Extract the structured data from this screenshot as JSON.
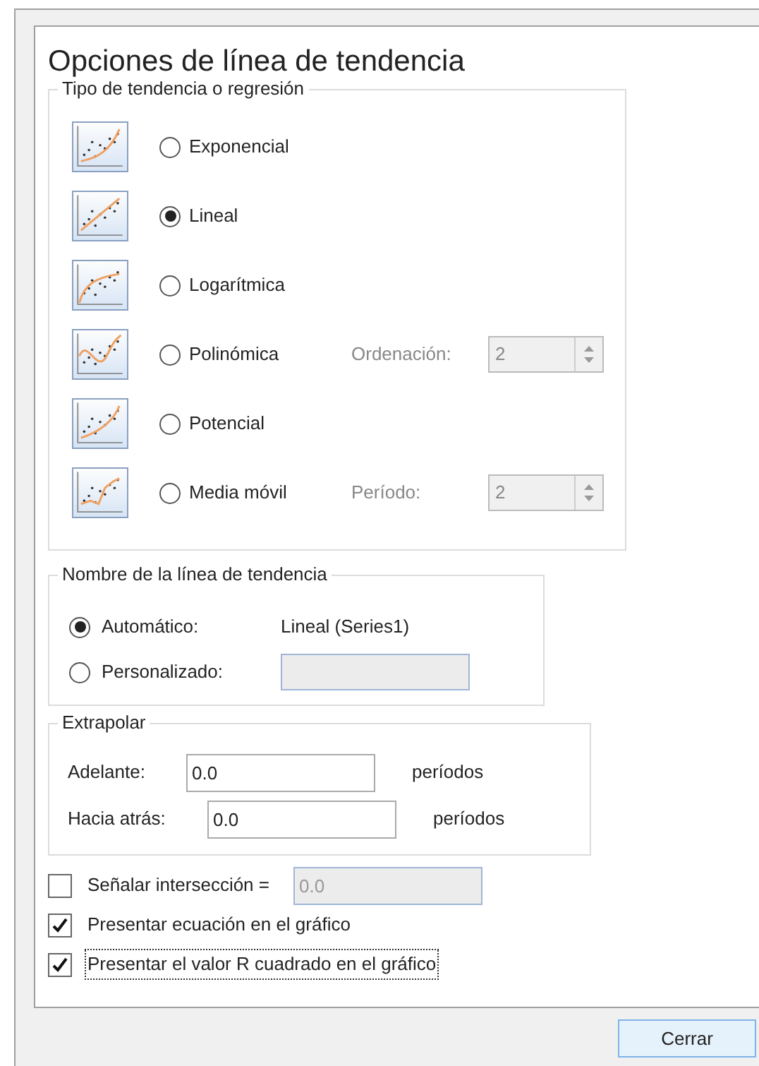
{
  "title": "Opciones de línea de tendencia",
  "trend_type": {
    "legend": "Tipo de tendencia o regresión",
    "options": [
      {
        "kind": "exponential",
        "label": "Exponencial",
        "selected": false
      },
      {
        "kind": "linear",
        "label": "Lineal",
        "selected": true
      },
      {
        "kind": "logarithmic",
        "label": "Logarítmica",
        "selected": false
      },
      {
        "kind": "polynomial",
        "label": "Polinómica",
        "selected": false,
        "param": {
          "label": "Ordenación:",
          "value": "2",
          "disabled": true
        }
      },
      {
        "kind": "power",
        "label": "Potencial",
        "selected": false
      },
      {
        "kind": "moving_average",
        "label": "Media móvil",
        "selected": false,
        "param": {
          "label": "Período:",
          "value": "2",
          "disabled": true
        }
      }
    ]
  },
  "trendline_name": {
    "legend": "Nombre de la línea de tendencia",
    "options": [
      {
        "kind": "auto",
        "label": "Automático:",
        "selected": true,
        "value": "Lineal (Series1)"
      },
      {
        "kind": "custom",
        "label": "Personalizado:",
        "selected": false,
        "field_disabled": true
      }
    ]
  },
  "extrapolate": {
    "legend": "Extrapolar",
    "fields": [
      {
        "label": "Adelante:",
        "value": "0.0",
        "unit": "períodos"
      },
      {
        "label": "Hacia atrás:",
        "value": "0.0",
        "unit": "períodos"
      }
    ]
  },
  "checks": [
    {
      "label": "Señalar intersección =",
      "checked": false,
      "field": {
        "value": "0.0",
        "disabled": true
      }
    },
    {
      "label": "Presentar ecuación en el gráfico",
      "checked": true
    },
    {
      "label": "Presentar el valor R cuadrado en el gráfico",
      "checked": true,
      "focused": true
    }
  ],
  "close_button": "Cerrar"
}
